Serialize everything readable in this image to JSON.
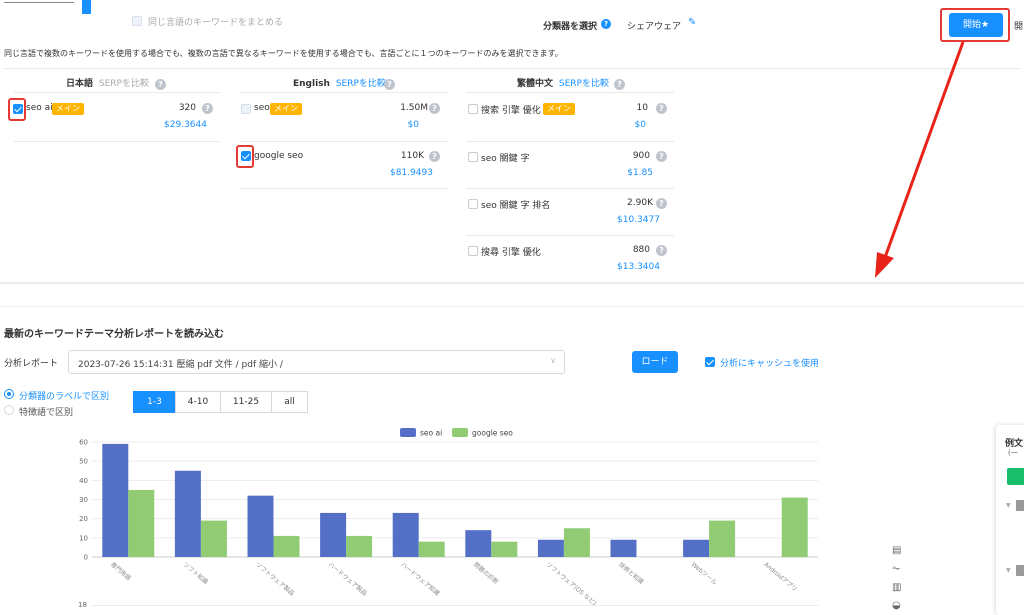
{
  "top": {
    "merge_label": "同じ言語のキーワードをまとめる",
    "classifier_label": "分類器を選択",
    "classifier_value": "シェアウェア",
    "start_button": "開始★",
    "start_button_cut": "開",
    "notice": "同じ言語で複数のキーワードを使用する場合でも、複数の言語で異なるキーワードを使用する場合でも、言語ごとに１つのキーワードのみを選択できます。"
  },
  "columns": [
    {
      "lang": "日本語",
      "compare": "SERPを比較",
      "compare_enabled": false,
      "rows": [
        {
          "keyword": "seo ai",
          "main": "メイン",
          "checked": true,
          "volume": "320",
          "cpc": "$29.3644"
        }
      ]
    },
    {
      "lang": "English",
      "compare": "SERPを比較",
      "compare_enabled": true,
      "rows": [
        {
          "keyword": "seo",
          "main": "メイン",
          "checked": false,
          "volume": "1.50M",
          "cpc": "$0"
        },
        {
          "keyword": "google seo",
          "main": "",
          "checked": true,
          "volume": "110K",
          "cpc": "$81.9493"
        }
      ]
    },
    {
      "lang": "繁體中文",
      "compare": "SERPを比較",
      "compare_enabled": true,
      "rows": [
        {
          "keyword": "搜索 引擎 優化",
          "main": "メイン",
          "checked": false,
          "volume": "10",
          "cpc": "$0"
        },
        {
          "keyword": "seo 關鍵 字",
          "main": "",
          "checked": false,
          "volume": "900",
          "cpc": "$1.85"
        },
        {
          "keyword": "seo 關鍵 字 排名",
          "main": "",
          "checked": false,
          "volume": "2.90K",
          "cpc": "$10.3477"
        },
        {
          "keyword": "搜尋 引擎 優化",
          "main": "",
          "checked": false,
          "volume": "880",
          "cpc": "$13.3404"
        }
      ]
    }
  ],
  "report": {
    "section_title": "最新のキーワードテーマ分析レポートを読み込む",
    "label": "分析レポート",
    "select_value": "2023-07-26 15:14:31 壓縮 pdf 文件 / pdf 縮小 /",
    "load_button": "ロード",
    "cache_label": "分析にキャッシュを使用",
    "radio_1": "分類器のラベルで区別",
    "radio_2": "特徴語で区別",
    "tabs": [
      "1-3",
      "4-10",
      "11-25",
      "all"
    ],
    "active_tab": 0,
    "bottom_tick": "18"
  },
  "side_panel": {
    "title": "例文",
    "sub": "(一"
  },
  "chart_data": {
    "type": "bar",
    "categories": [
      "専門用語",
      "ソフト知識",
      "ソフトウェア製品",
      "ハードウェア製品",
      "ハードウェア知識",
      "問題の診断",
      "ソフトウェア(OS など)",
      "技術と知識",
      "Webツール",
      "Androidアプリ"
    ],
    "series": [
      {
        "name": "seo ai",
        "color": "#5470c6",
        "values": [
          59,
          45,
          32,
          23,
          23,
          14,
          9,
          9,
          9,
          0
        ]
      },
      {
        "name": "google seo",
        "color": "#91cc75",
        "values": [
          35,
          19,
          11,
          11,
          8,
          8,
          15,
          0,
          19,
          31
        ]
      }
    ],
    "ylim": [
      0,
      60
    ],
    "yticks": [
      0,
      10,
      20,
      30,
      40,
      50,
      60
    ],
    "grid": true,
    "legend": "top-center"
  }
}
